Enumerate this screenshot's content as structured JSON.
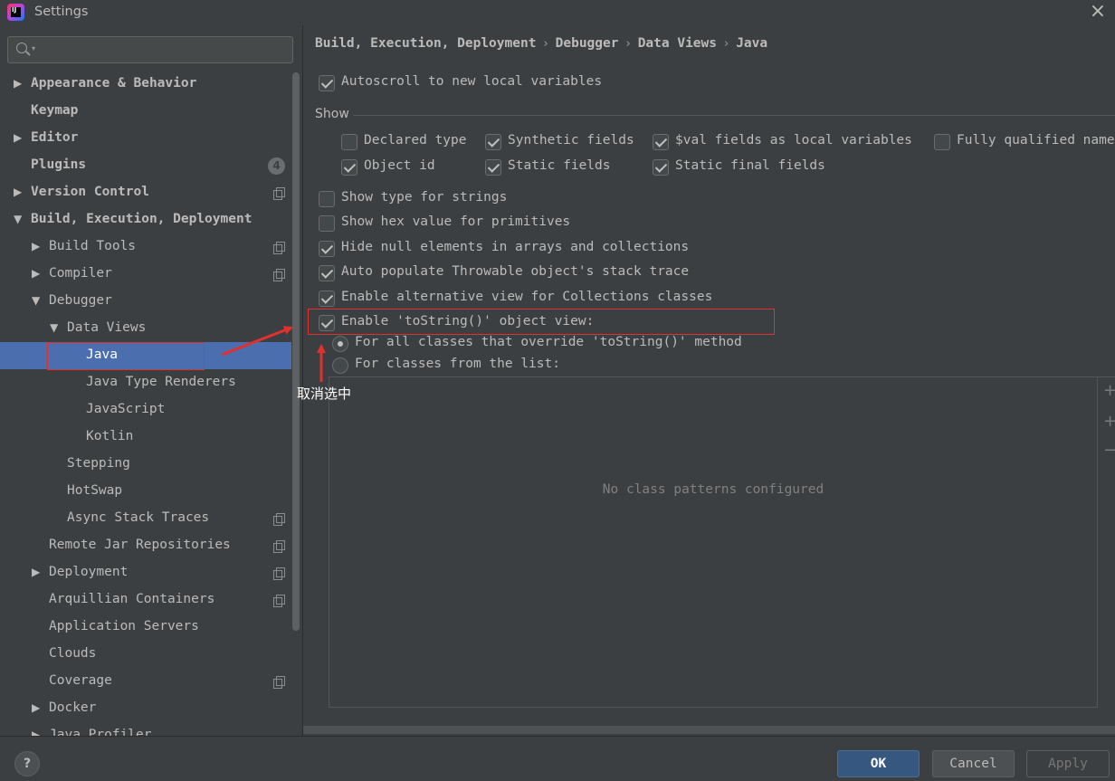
{
  "window": {
    "title": "Settings"
  },
  "search": {
    "placeholder": ""
  },
  "sidebar": {
    "items": [
      {
        "label": "Appearance & Behavior",
        "arrow": "▶",
        "bold": true
      },
      {
        "label": "Keymap",
        "arrow": "",
        "bold": true
      },
      {
        "label": "Editor",
        "arrow": "▶",
        "bold": true
      },
      {
        "label": "Plugins",
        "arrow": "",
        "bold": true,
        "badge": "4"
      },
      {
        "label": "Version Control",
        "arrow": "▶",
        "bold": true
      },
      {
        "label": "Build, Execution, Deployment",
        "arrow": "▼",
        "bold": true
      },
      {
        "label": "Build Tools",
        "arrow": "▶"
      },
      {
        "label": "Compiler",
        "arrow": "▶"
      },
      {
        "label": "Debugger",
        "arrow": "▼"
      },
      {
        "label": "Data Views",
        "arrow": "▼"
      },
      {
        "label": "Java",
        "arrow": "",
        "selected": true
      },
      {
        "label": "Java Type Renderers",
        "arrow": ""
      },
      {
        "label": "JavaScript",
        "arrow": ""
      },
      {
        "label": "Kotlin",
        "arrow": ""
      },
      {
        "label": "Stepping",
        "arrow": ""
      },
      {
        "label": "HotSwap",
        "arrow": ""
      },
      {
        "label": "Async Stack Traces",
        "arrow": ""
      },
      {
        "label": "Remote Jar Repositories",
        "arrow": ""
      },
      {
        "label": "Deployment",
        "arrow": "▶"
      },
      {
        "label": "Arquillian Containers",
        "arrow": ""
      },
      {
        "label": "Application Servers",
        "arrow": ""
      },
      {
        "label": "Clouds",
        "arrow": ""
      },
      {
        "label": "Coverage",
        "arrow": ""
      },
      {
        "label": "Docker",
        "arrow": "▶"
      },
      {
        "label": "Java Profiler",
        "arrow": "▶"
      }
    ]
  },
  "breadcrumb": {
    "items": [
      "Build, Execution, Deployment",
      "Debugger",
      "Data Views",
      "Java"
    ],
    "separator": "›"
  },
  "settings": {
    "autoscroll": {
      "label": "Autoscroll to new local variables",
      "checked": true
    },
    "show_group_label": "Show",
    "show": {
      "declared_type": {
        "label": "Declared type",
        "checked": false
      },
      "synthetic_fields": {
        "label": "Synthetic fields",
        "checked": true
      },
      "val_fields": {
        "label": "$val fields as local variables",
        "checked": true
      },
      "fully_qualified": {
        "label": "Fully qualified names",
        "checked": false
      },
      "object_id": {
        "label": "Object id",
        "checked": true
      },
      "static_fields": {
        "label": "Static fields",
        "checked": true
      },
      "static_final_fields": {
        "label": "Static final fields",
        "checked": true
      }
    },
    "show_type_strings": {
      "label": "Show type for strings",
      "checked": false
    },
    "show_hex": {
      "label": "Show hex value for primitives",
      "checked": false
    },
    "hide_null": {
      "label": "Hide null elements in arrays and collections",
      "checked": true
    },
    "auto_populate": {
      "label": "Auto populate Throwable object's stack trace",
      "checked": true
    },
    "alt_view": {
      "label": "Enable alternative view for Collections classes",
      "checked": true
    },
    "tostring_view": {
      "label": "Enable 'toString()' object view:",
      "checked": true
    },
    "radio_all": {
      "label": "For all classes that override 'toString()' method",
      "selected": true
    },
    "radio_list": {
      "label": "For classes from the list:",
      "selected": false
    },
    "list_empty_text": "No class patterns configured"
  },
  "list_toolbar": {
    "add_label": "+",
    "add_pattern_label": "+",
    "remove_label": "−"
  },
  "annotation": {
    "text": "取消选中",
    "color": "#e0312f"
  },
  "buttons": {
    "help": "?",
    "ok": "OK",
    "cancel": "Cancel",
    "apply": "Apply"
  },
  "colors": {
    "background": "#3c3f41",
    "selection": "#4b6eaf",
    "ok_button": "#365880"
  }
}
